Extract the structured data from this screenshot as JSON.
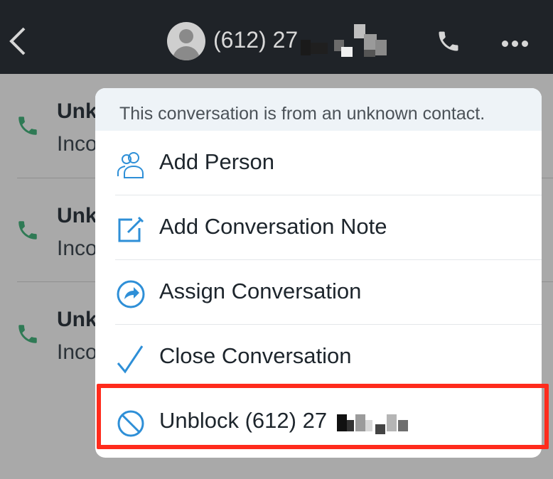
{
  "header": {
    "title": "(612) 27",
    "back_icon": "chevron-left-icon",
    "call_icon": "phone-icon",
    "more_icon": "more-icon"
  },
  "conversations": [
    {
      "name": "Unk",
      "subtitle": "Inco"
    },
    {
      "name": "Unk",
      "subtitle": "Inco"
    },
    {
      "name": "Unk",
      "subtitle": "Inco"
    }
  ],
  "menu": {
    "header_text": "This conversation is from an unknown contact.",
    "items": [
      {
        "label": "Add Person",
        "icon": "people-icon"
      },
      {
        "label": "Add Conversation Note",
        "icon": "note-edit-icon"
      },
      {
        "label": "Assign Conversation",
        "icon": "assign-arrow-icon"
      },
      {
        "label": "Close Conversation",
        "icon": "checkmark-icon"
      },
      {
        "label": "Unblock (612) 27",
        "icon": "unblock-icon"
      }
    ]
  },
  "colors": {
    "accent": "#2e8fd7",
    "call_green": "#2f9a63",
    "highlight": "#ff2b1c",
    "header_bg": "#1f2328"
  }
}
